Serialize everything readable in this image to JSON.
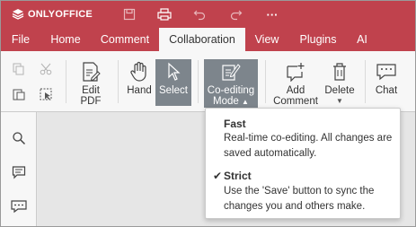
{
  "app": {
    "logo_text": "ONLYOFFICE",
    "title_icons": [
      "save-icon",
      "print-icon",
      "undo-icon",
      "redo-icon",
      "more-icon"
    ],
    "more_label": "···"
  },
  "tabs": [
    {
      "label": "File"
    },
    {
      "label": "Home"
    },
    {
      "label": "Comment"
    },
    {
      "label": "Collaboration"
    },
    {
      "label": "View"
    },
    {
      "label": "Plugins"
    },
    {
      "label": "AI"
    }
  ],
  "active_tab": "Collaboration",
  "toolbar": {
    "edit_pdf_line1": "Edit",
    "edit_pdf_line2": "PDF",
    "hand": "Hand",
    "select": "Select",
    "coediting_line1": "Co-editing",
    "coediting_line2": "Mode",
    "add_comment_line1": "Add",
    "add_comment_line2": "Comment",
    "delete": "Delete",
    "chat": "Chat"
  },
  "coediting_menu": {
    "fast_title": "Fast",
    "fast_desc": "Real-time co-editing. All changes are saved automatically.",
    "strict_title": "Strict",
    "strict_desc": "Use the 'Save' button to sync the changes you and others make.",
    "selected": "Strict",
    "check_mark": "✔"
  },
  "left_panel": {
    "icons": [
      "search-icon",
      "comment-icon",
      "chat-icon"
    ]
  },
  "colors": {
    "header": "#c0424d",
    "toolbar": "#f7f7f7",
    "selected_button": "#7d858c"
  }
}
